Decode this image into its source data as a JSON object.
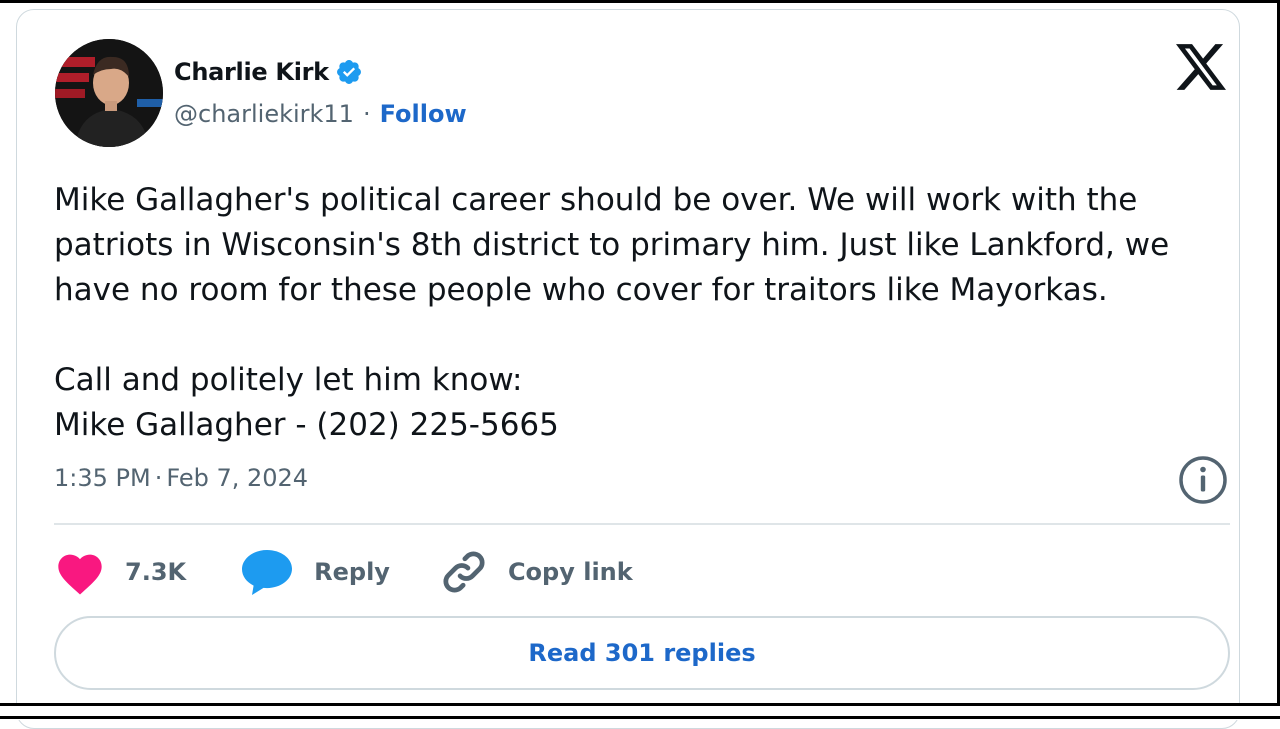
{
  "author": {
    "name": "Charlie Kirk",
    "handle": "@charliekirk11",
    "separator": "·",
    "follow_label": "Follow",
    "verified": true
  },
  "tweet": {
    "text": "Mike Gallagher's political career should be over. We will work with the patriots in Wisconsin's 8th district to primary him. Just like Lankford, we have no room for these people who cover for traitors like Mayorkas.\n\nCall and politely let him know:\nMike Gallagher - (202) 225-5665",
    "time": "1:35 PM",
    "date_separator": "·",
    "date": "Feb 7, 2024"
  },
  "actions": {
    "like_count": "7.3K",
    "reply_label": "Reply",
    "copy_label": "Copy link"
  },
  "footer": {
    "read_replies_label": "Read 301 replies"
  },
  "icons": {
    "logo": "x-logo-icon",
    "verified": "verified-badge-icon",
    "info": "info-icon",
    "like": "heart-icon",
    "reply": "speech-bubble-icon",
    "copy": "link-icon"
  },
  "colors": {
    "accent_blue": "#1d68c9",
    "verified_blue": "#1d9bf0",
    "heart_pink": "#f91880",
    "text_primary": "#0f1419",
    "text_secondary": "#536471",
    "border": "#cfd9de"
  }
}
